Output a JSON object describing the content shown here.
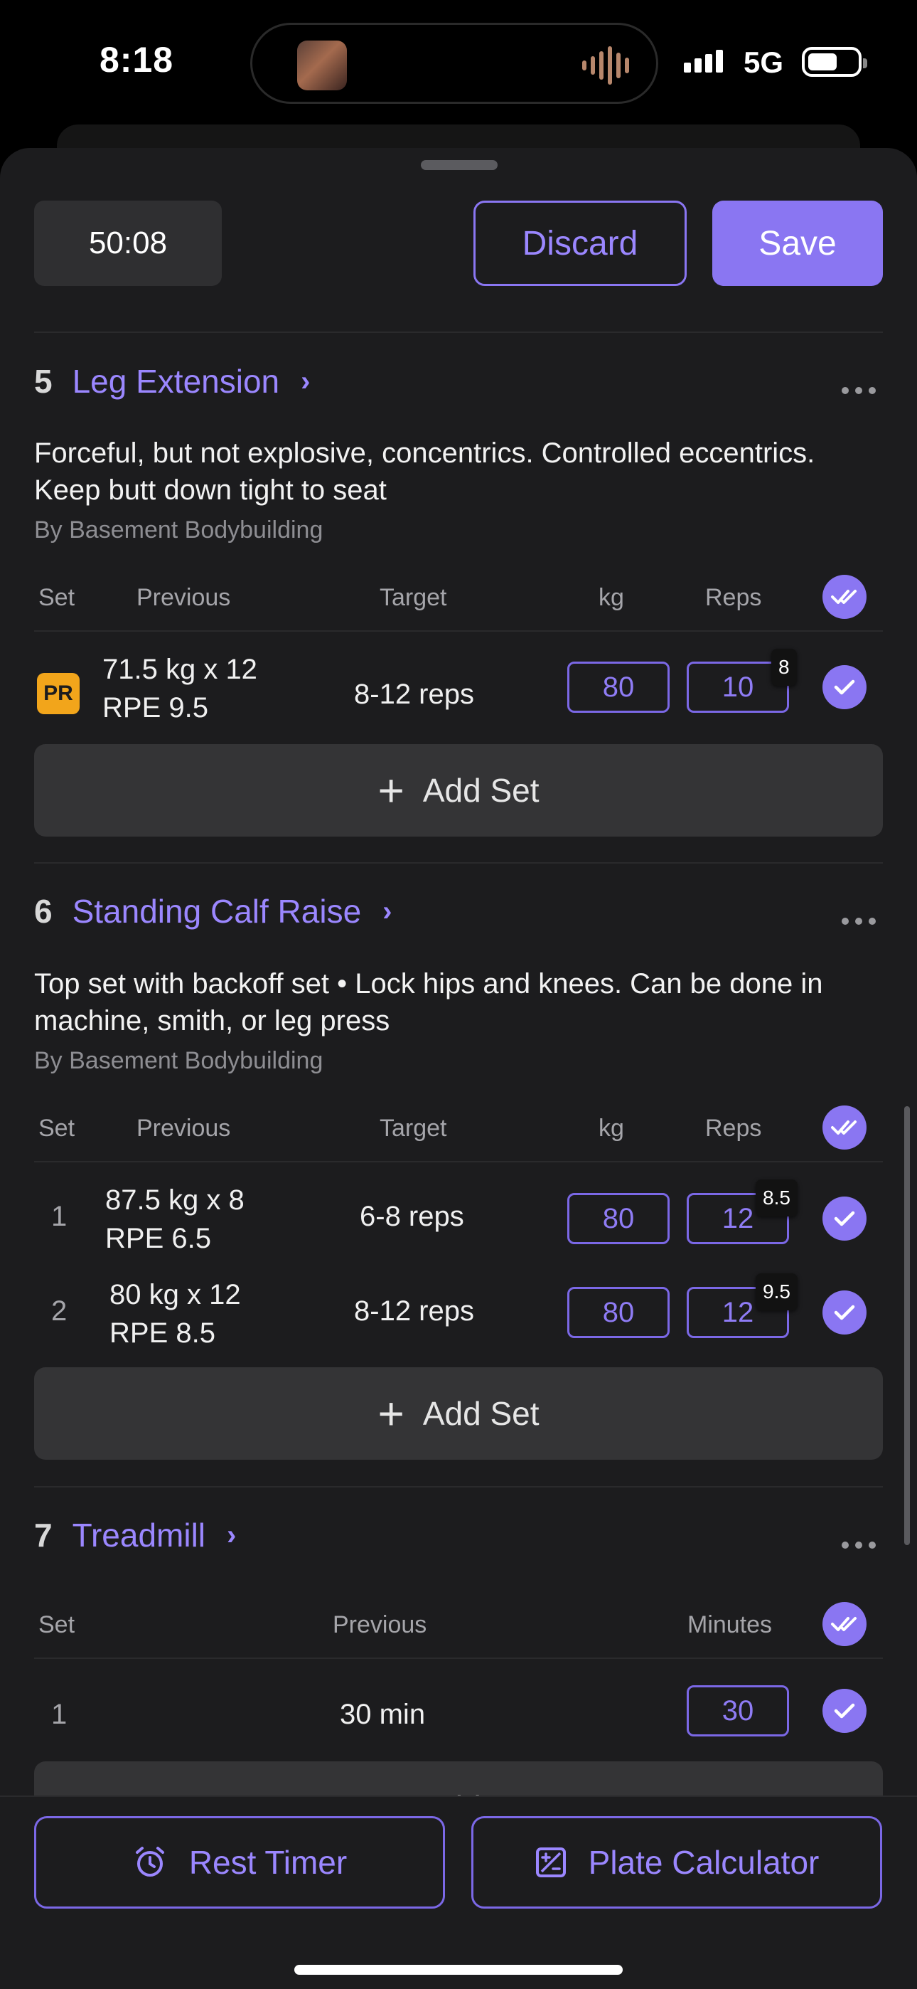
{
  "status_bar": {
    "time": "8:18",
    "network": "5G"
  },
  "header": {
    "timer": "50:08",
    "discard_label": "Discard",
    "save_label": "Save"
  },
  "exercises": [
    {
      "number": "5",
      "name": "Leg Extension",
      "description": "Forceful, but not explosive, concentrics. Controlled eccentrics. Keep butt down tight to seat",
      "author": "By Basement Bodybuilding",
      "columns": {
        "set": "Set",
        "previous": "Previous",
        "target": "Target",
        "kg": "kg",
        "reps": "Reps"
      },
      "sets": [
        {
          "set": "PR",
          "prev_line1": "71.5 kg x 12",
          "prev_line2": "RPE 9.5",
          "target": "8-12 reps",
          "kg": "80",
          "reps": "10",
          "rpe": "8"
        }
      ],
      "add_set_label": "Add Set"
    },
    {
      "number": "6",
      "name": "Standing Calf Raise",
      "description": "Top set with backoff set • Lock hips and knees. Can be done in machine, smith, or leg press",
      "author": "By Basement Bodybuilding",
      "columns": {
        "set": "Set",
        "previous": "Previous",
        "target": "Target",
        "kg": "kg",
        "reps": "Reps"
      },
      "sets": [
        {
          "set": "1",
          "prev_line1": "87.5 kg x 8",
          "prev_line2": "RPE 6.5",
          "target": "6-8 reps",
          "kg": "80",
          "reps": "12",
          "rpe": "8.5"
        },
        {
          "set": "2",
          "prev_line1": "80 kg x 12",
          "prev_line2": "RPE 8.5",
          "target": "8-12 reps",
          "kg": "80",
          "reps": "12",
          "rpe": "9.5"
        }
      ],
      "add_set_label": "Add Set"
    },
    {
      "number": "7",
      "name": "Treadmill",
      "columns": {
        "set": "Set",
        "previous": "Previous",
        "minutes": "Minutes"
      },
      "sets": [
        {
          "set": "1",
          "previous": "30 min",
          "minutes": "30"
        }
      ],
      "add_set_label": "Add Set"
    }
  ],
  "bottom_bar": {
    "rest_timer_label": "Rest Timer",
    "plate_calculator_label": "Plate Calculator"
  },
  "colors": {
    "accent": "#8a76f2",
    "pr_badge": "#f2a51b",
    "background": "#1c1c1e"
  }
}
